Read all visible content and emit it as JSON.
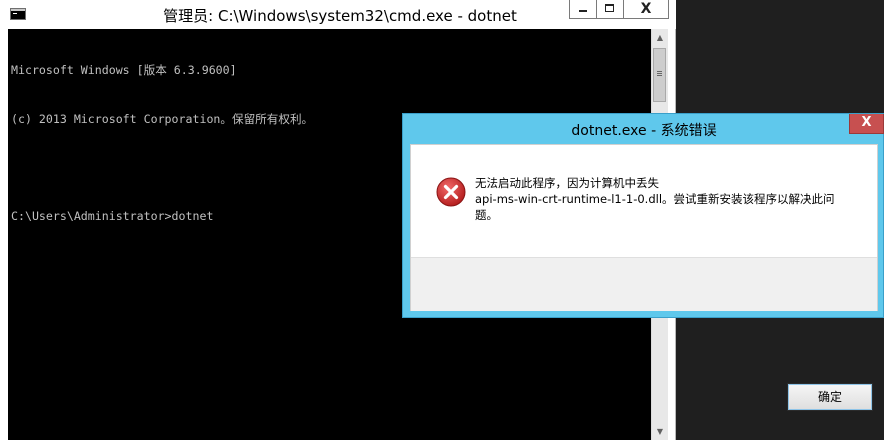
{
  "cmd_window": {
    "title": "管理员: C:\\Windows\\system32\\cmd.exe - dotnet",
    "close_glyph": "X",
    "console_lines": [
      "Microsoft Windows [版本 6.3.9600]",
      "(c) 2013 Microsoft Corporation。保留所有权利。",
      "",
      "C:\\Users\\Administrator>dotnet"
    ]
  },
  "error_dialog": {
    "title": "dotnet.exe - 系统错误",
    "close_glyph": "X",
    "message_lines": [
      "无法启动此程序，因为计算机中丢失",
      "api-ms-win-crt-runtime-l1-1-0.dll。尝试重新安装该程序以解决此问",
      "题。"
    ],
    "ok_label": "确定",
    "icon": "error-icon"
  },
  "colors": {
    "dialog_frame": "#5fc8ec",
    "console_bg": "#000000",
    "console_text": "#c0c0c0",
    "dialog_close": "#c75050",
    "error_icon": "#c62828"
  }
}
